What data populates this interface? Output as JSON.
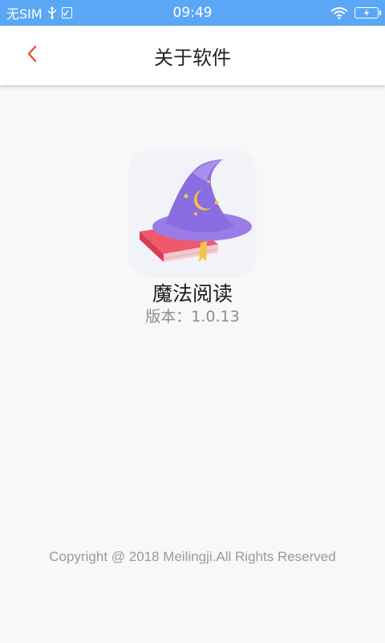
{
  "status_bar": {
    "carrier": "无SIM",
    "time": "09:49",
    "icons": [
      "usb-icon",
      "sd-card-icon",
      "wifi-icon",
      "battery-charging-icon"
    ],
    "background_color": "#5aa8f5"
  },
  "nav": {
    "title": "关于软件",
    "back_icon": "chevron-left-icon",
    "accent_color": "#e8532b"
  },
  "app": {
    "name": "魔法阅读",
    "version_text": "版本：1.0.13",
    "icon": "wizard-hat-book-icon"
  },
  "footer": {
    "copyright": "Copyright @ 2018 Meilingji.All Rights Reserved"
  }
}
